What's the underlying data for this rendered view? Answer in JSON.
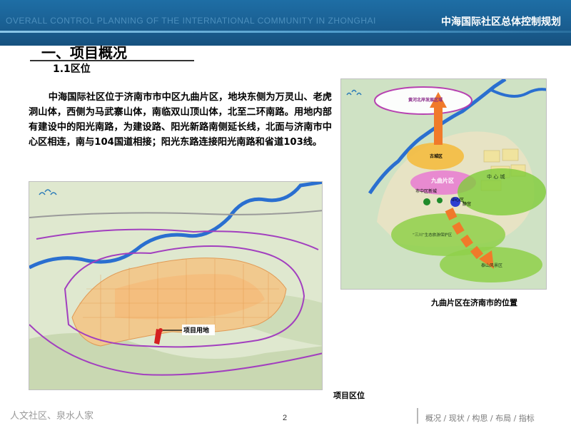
{
  "header": {
    "english_title": "OVERALL CONTROL  PLANNING OF THE INTERNATIONAL  COMMUNITY IN ZHONGHAI",
    "chinese_title": "中海国际社区总体控制规划"
  },
  "section": {
    "title": "一、项目概况",
    "subtitle": "1.1区位"
  },
  "body": {
    "paragraph": "中海国际社区位于济南市市中区九曲片区，地块东侧为万灵山、老虎洞山体，西侧为马武寨山体，南临双山顶山体，北至二环南路。用地内部有建设中的阳光南路，为建设路、阳光新路南侧延长线，北面与济南市中心区相连，南与104国道相接；阳光东路连接阳光南路和省道103线。"
  },
  "main_map": {
    "marker_label": "项目用地",
    "caption": "项目区位"
  },
  "inset_map": {
    "caption": "九曲片区在济南市的位置",
    "labels": {
      "top_zone": "黄河北岸发展区域",
      "old_town": "古城区",
      "jiuqu": "九曲片区",
      "center_new": "中心区",
      "new_district": "市中区新城",
      "sanchuan": "“三川”生态旅游保护区",
      "scenic": "泰山风景区",
      "zone": "中  心  城",
      "shengtai": "生态保护区",
      "jingyu": "静宫",
      "new_city": "南部新城"
    }
  },
  "footer": {
    "slogan": "人文社区、泉水人家",
    "page_number": "2",
    "nav": "概况 / 现状 / 构思 / 布局 / 指标"
  },
  "colors": {
    "header_blue": "#1a5f92",
    "arrow_orange": "#f07a2a",
    "ellipse_green": "#7fcc3a",
    "river_blue": "#2a6fd0",
    "marker_red": "#d42020"
  }
}
